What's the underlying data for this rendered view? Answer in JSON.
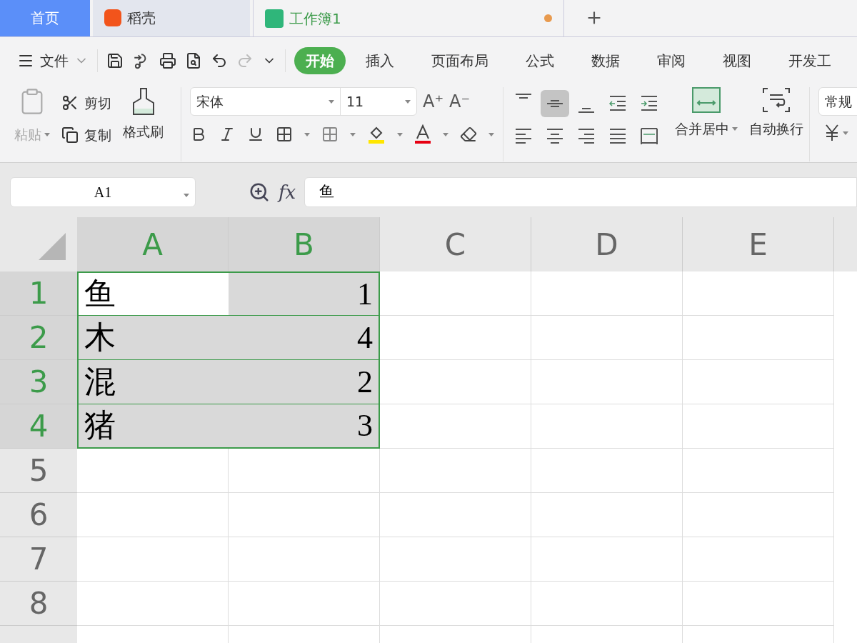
{
  "tabs": [
    {
      "label": "首页",
      "kind": "home",
      "selected": false
    },
    {
      "label": "稻壳",
      "kind": "docer",
      "selected": false
    },
    {
      "label": "工作簿1",
      "kind": "sheet",
      "selected": true,
      "unsaved": true
    }
  ],
  "menu": {
    "file": "文件",
    "ribbon_tabs": [
      {
        "label": "开始",
        "selected": true
      },
      {
        "label": "插入",
        "selected": false
      },
      {
        "label": "页面布局",
        "selected": false
      },
      {
        "label": "公式",
        "selected": false
      },
      {
        "label": "数据",
        "selected": false
      },
      {
        "label": "审阅",
        "selected": false
      },
      {
        "label": "视图",
        "selected": false
      },
      {
        "label": "开发工",
        "selected": false
      }
    ]
  },
  "ribbon": {
    "paste": {
      "label": "粘贴",
      "disabled": true
    },
    "cut": "剪切",
    "copy": "复制",
    "format_painter": "格式刷",
    "font_name": "宋体",
    "font_size": "11",
    "grow_font": "A⁺",
    "shrink_font": "A⁻",
    "align_buttons": [
      {
        "kind": "top",
        "selected": false
      },
      {
        "kind": "middle",
        "selected": true
      },
      {
        "kind": "bottom",
        "selected": false
      },
      {
        "kind": "outdent",
        "selected": false
      },
      {
        "kind": "indent",
        "selected": false
      },
      {
        "kind": "left",
        "selected": false
      },
      {
        "kind": "center",
        "selected": false
      },
      {
        "kind": "right",
        "selected": false
      },
      {
        "kind": "justify",
        "selected": false
      },
      {
        "kind": "distribute",
        "selected": false
      }
    ],
    "merge": "合并居中",
    "wrap": "自动换行",
    "number_format": "常规"
  },
  "formula_bar": {
    "name_box": "A1",
    "function_label": "fx",
    "formula": "鱼"
  },
  "sheet": {
    "columns": [
      {
        "label": "A",
        "selected": true
      },
      {
        "label": "B",
        "selected": true
      },
      {
        "label": "C",
        "selected": false
      },
      {
        "label": "D",
        "selected": false
      },
      {
        "label": "E",
        "selected": false
      }
    ],
    "rows": [
      {
        "label": "1",
        "selected": true,
        "cells": [
          {
            "value": "鱼",
            "kind": "text",
            "selected": true,
            "active": true
          },
          {
            "value": "1",
            "kind": "number",
            "selected": true,
            "active": false
          }
        ]
      },
      {
        "label": "2",
        "selected": true,
        "cells": [
          {
            "value": "木",
            "kind": "text",
            "selected": true,
            "active": false
          },
          {
            "value": "4",
            "kind": "number",
            "selected": true,
            "active": false
          }
        ]
      },
      {
        "label": "3",
        "selected": true,
        "cells": [
          {
            "value": "混",
            "kind": "text",
            "selected": true,
            "active": false
          },
          {
            "value": "2",
            "kind": "number",
            "selected": true,
            "active": false
          }
        ]
      },
      {
        "label": "4",
        "selected": true,
        "cells": [
          {
            "value": "猪",
            "kind": "text",
            "selected": true,
            "active": false
          },
          {
            "value": "3",
            "kind": "number",
            "selected": true,
            "active": false
          }
        ]
      },
      {
        "label": "5",
        "selected": false,
        "cells": []
      },
      {
        "label": "6",
        "selected": false,
        "cells": []
      },
      {
        "label": "7",
        "selected": false,
        "cells": []
      },
      {
        "label": "8",
        "selected": false,
        "cells": []
      }
    ]
  }
}
